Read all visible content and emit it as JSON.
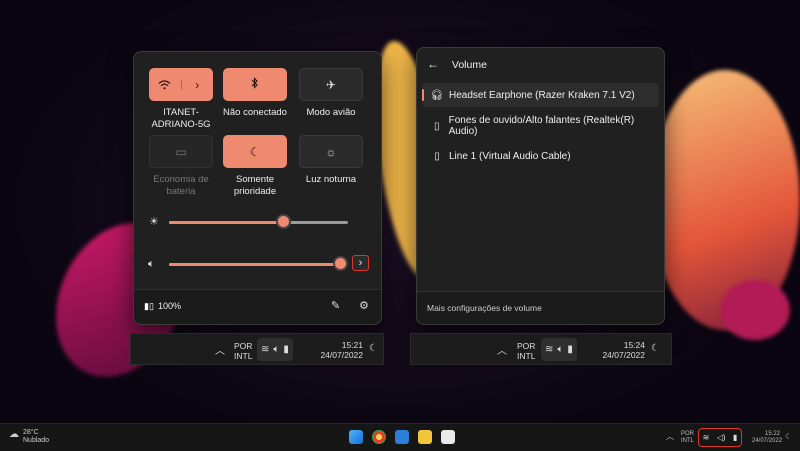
{
  "quick_settings": {
    "tiles": [
      {
        "label": "ITANET-ADRIANO-5G",
        "state": "on",
        "icon": "wifi-icon"
      },
      {
        "label": "Não conectado",
        "state": "on",
        "icon": "bluetooth-icon"
      },
      {
        "label": "Modo avião",
        "state": "off",
        "icon": "airplane-icon"
      },
      {
        "label": "Economia de bateria",
        "state": "disabled",
        "icon": "battery-saver-icon"
      },
      {
        "label": "Somente prioridade",
        "state": "on",
        "icon": "focus-moon-icon"
      },
      {
        "label": "Luz noturna",
        "state": "off",
        "icon": "night-light-icon"
      }
    ],
    "brightness_level": 0.64,
    "volume_level": 0.97,
    "battery_text": "100%"
  },
  "volume_panel": {
    "title": "Volume",
    "devices": [
      {
        "name": "Headset Earphone (Razer Kraken 7.1 V2)",
        "icon": "headset-icon",
        "selected": true
      },
      {
        "name": "Fones de ouvido/Alto falantes (Realtek(R) Audio)",
        "icon": "speaker-icon",
        "selected": false
      },
      {
        "name": "Line 1 (Virtual Audio Cable)",
        "icon": "speaker-icon",
        "selected": false
      }
    ],
    "footer_link": "Mais configurações de volume"
  },
  "mini_taskbar_1": {
    "lang_line1": "POR",
    "lang_line2": "INTL",
    "time": "15:21",
    "date": "24/07/2022"
  },
  "mini_taskbar_2": {
    "lang_line1": "POR",
    "lang_line2": "INTL",
    "time": "15:24",
    "date": "24/07/2022"
  },
  "taskbar": {
    "weather_temp": "28°C",
    "weather_desc": "Nublado",
    "lang_line1": "POR",
    "lang_line2": "INTL",
    "time": "15:22",
    "date": "24/07/2022"
  },
  "colors": {
    "accent": "#ef8a70",
    "highlight_box": "#e0352c",
    "panel_bg": "#202020"
  }
}
